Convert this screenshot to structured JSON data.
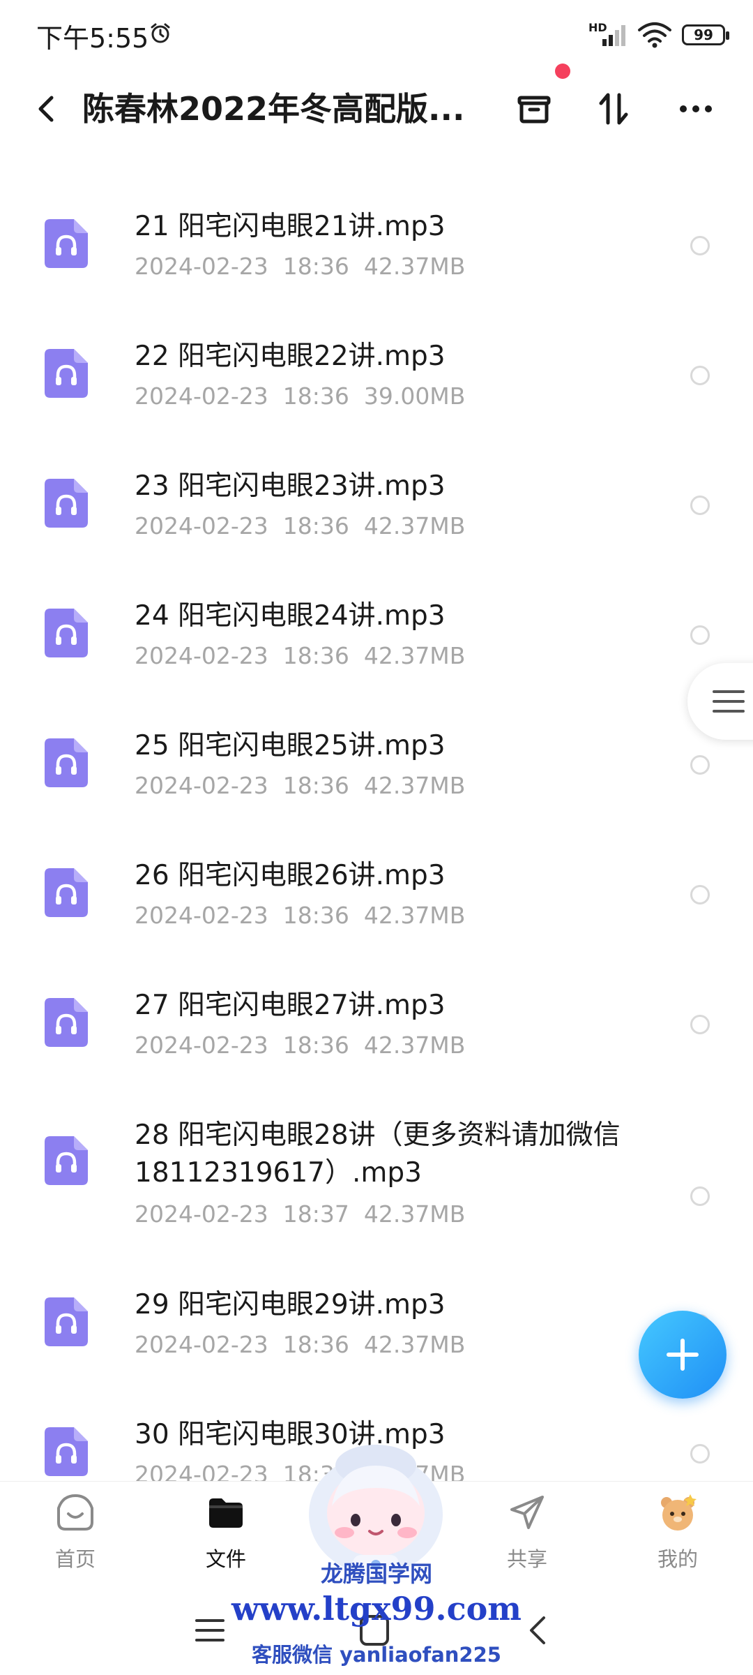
{
  "status_bar": {
    "time": "下午5:55",
    "network_label": "HD",
    "battery": "99"
  },
  "header": {
    "title": "陈春林2022年冬高配版..."
  },
  "files": [
    {
      "name": "21 阳宅闪电眼21讲.mp3",
      "meta": "2024-02-23  18:36  42.37MB"
    },
    {
      "name": "22 阳宅闪电眼22讲.mp3",
      "meta": "2024-02-23  18:36  39.00MB"
    },
    {
      "name": "23 阳宅闪电眼23讲.mp3",
      "meta": "2024-02-23  18:36  42.37MB"
    },
    {
      "name": "24 阳宅闪电眼24讲.mp3",
      "meta": "2024-02-23  18:36  42.37MB"
    },
    {
      "name": "25 阳宅闪电眼25讲.mp3",
      "meta": "2024-02-23  18:36  42.37MB"
    },
    {
      "name": "26 阳宅闪电眼26讲.mp3",
      "meta": "2024-02-23  18:36  42.37MB"
    },
    {
      "name": "27 阳宅闪电眼27讲.mp3",
      "meta": "2024-02-23  18:36  42.37MB"
    },
    {
      "name": "28 阳宅闪电眼28讲（更多资料请加微信18112319617）.mp3",
      "meta": "2024-02-23  18:37  42.37MB"
    },
    {
      "name": "29 阳宅闪电眼29讲.mp3",
      "meta": "2024-02-23  18:36  42.37MB"
    },
    {
      "name": "30 阳宅闪电眼30讲.mp3",
      "meta": "2024-02-23  18:36  42.37MB"
    }
  ],
  "bottom_nav": [
    {
      "label": "首页",
      "icon": "home-icon",
      "active": false
    },
    {
      "label": "文件",
      "icon": "folder-icon",
      "active": true
    },
    {
      "label": "",
      "icon": "mascot",
      "active": false
    },
    {
      "label": "共享",
      "icon": "share-icon",
      "active": false
    },
    {
      "label": "我的",
      "icon": "profile-icon",
      "active": false
    }
  ],
  "watermark": {
    "name": "龙腾国学网",
    "url": "www.ltgx99.com",
    "contact": "客服微信 yanliaofan225"
  },
  "colors": {
    "accent": "#1f8ff5",
    "file_icon": "#8c7ff0",
    "notification_dot": "#f5405d"
  }
}
